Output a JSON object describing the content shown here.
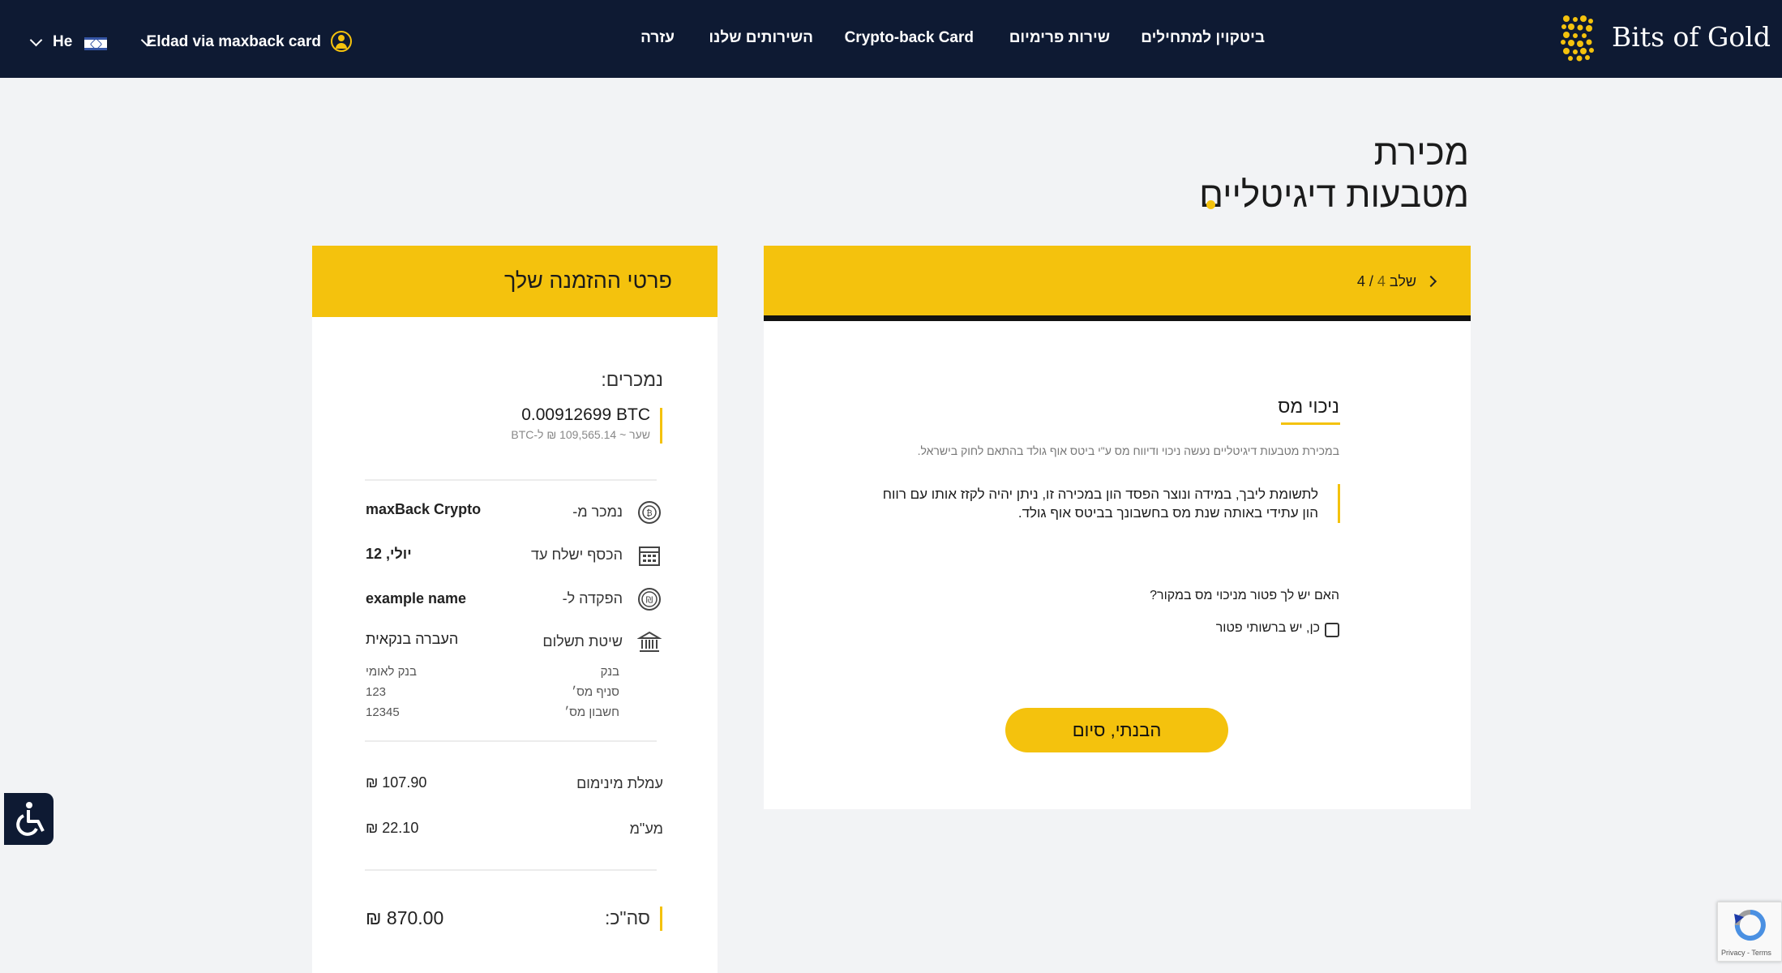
{
  "header": {
    "brand": "Bits of Gold",
    "nav": [
      {
        "label": "ביטקוין למתחילים"
      },
      {
        "label": "שירות פרימיום"
      },
      {
        "label": "Crypto-back Card"
      },
      {
        "label": "השירותים שלנו"
      },
      {
        "label": "עזרה"
      }
    ],
    "account_name": "Eldad via maxback card",
    "language": "He"
  },
  "page_title": {
    "line1": "מכירת",
    "line2": "מטבעות דיגיטליים"
  },
  "wizard": {
    "step_prefix": "שלב",
    "step_current": "4",
    "step_sep": "/",
    "step_total": "4",
    "section_title": "ניכוי מס",
    "note": "במכירת מטבעות דיגיטליים נעשה ניכוי ודיווח מס ע\"י ביטס אוף גולד בהתאם לחוק בישראל.",
    "info": "לתשומת ליבך, במידה ונוצר הפסד הון במכירה זו, ניתן יהיה לקזז אותו עם רווח הון עתידי באותה שנת מס בחשבונך בביטס אוף גולד.",
    "question": "האם יש לך פטור מניכוי מס במקור?",
    "checkbox_label": "כן, יש ברשותי פטור",
    "finish_button": "הבנתי, סיום"
  },
  "order": {
    "title": "פרטי ההזמנה שלך",
    "selling_label": "נמכרים:",
    "amount": "0.00912699 BTC",
    "rate": "שער ~ 109,565.14 ₪ ל-BTC",
    "rows": [
      {
        "label": "נמכר מ-",
        "value": "maxBack Crypto",
        "icon": "bitcoin-icon"
      },
      {
        "label": "הכסף ישלח עד",
        "value": "יולי, 12",
        "icon": "calendar-icon"
      },
      {
        "label": "הפקדה ל-",
        "value": "example name",
        "icon": "shekel-icon"
      },
      {
        "label": "שיטת תשלום",
        "value": "העברה בנקאית",
        "icon": "bank-icon"
      }
    ],
    "bank_details": [
      {
        "label": "בנק",
        "value": "בנק לאומי"
      },
      {
        "label": "סניף מס׳",
        "value": "123"
      },
      {
        "label": "חשבון מס׳",
        "value": "12345"
      }
    ],
    "fees": [
      {
        "label": "עמלת מינימום",
        "value": "₪ 107.90"
      },
      {
        "label": "מע\"מ",
        "value": "₪ 22.10"
      }
    ],
    "total_label": "סה\"כ:",
    "total_value": "₪ 870.00"
  },
  "recaptcha_text": "Privacy - Terms",
  "colors": {
    "header_bg": "#0e1a33",
    "accent": "#f4c20d",
    "page_bg": "#f2f3f5"
  }
}
